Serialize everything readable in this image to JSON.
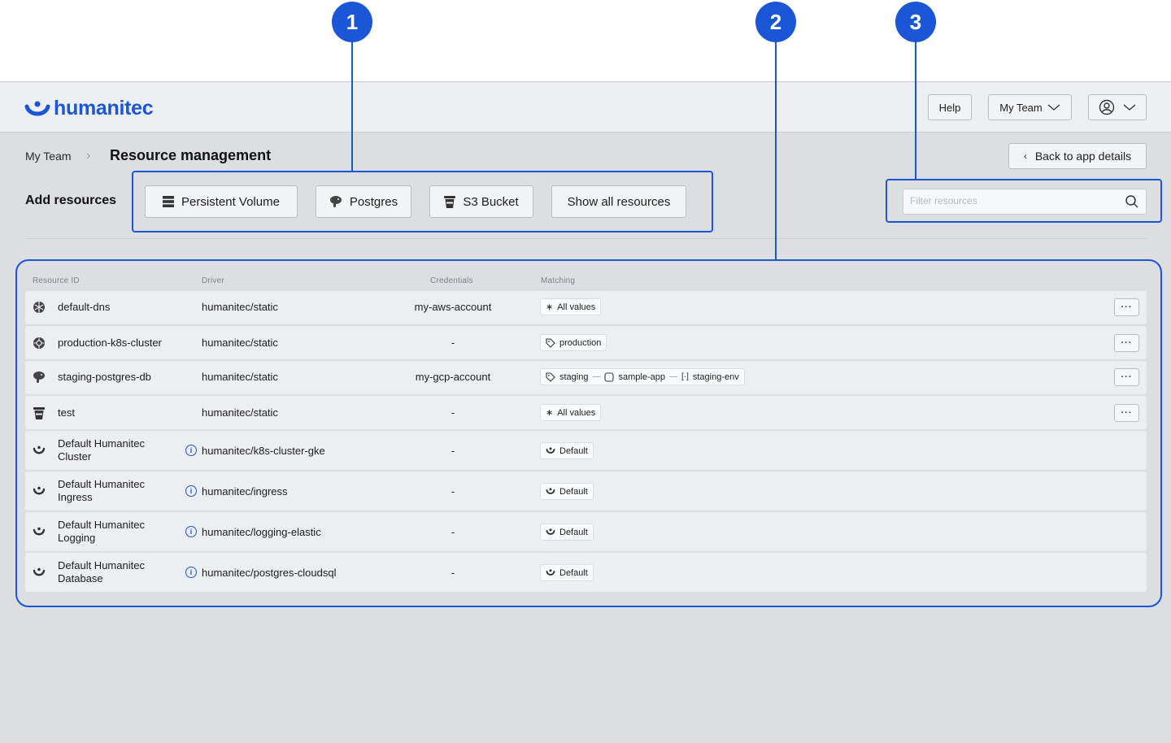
{
  "markers": [
    "1",
    "2",
    "3"
  ],
  "header": {
    "logo_text": "humanitec",
    "help_label": "Help",
    "team_label": "My Team"
  },
  "breadcrumb": {
    "team": "My Team",
    "title": "Resource management"
  },
  "back_button": "Back to app details",
  "add_resources": {
    "label": "Add resources",
    "buttons": [
      "Persistent Volume",
      "Postgres",
      "S3 Bucket",
      "Show all resources"
    ]
  },
  "filter": {
    "placeholder": "Filter resources"
  },
  "table": {
    "headers": [
      "Resource ID",
      "Driver",
      "Credentials",
      "Matching"
    ],
    "rows": [
      {
        "id": "default-dns",
        "icon": "dns-icon",
        "driver": "humanitec/static",
        "credentials": "my-aws-account",
        "matching": [
          {
            "icon": "asterisk-icon",
            "label": "All values"
          }
        ],
        "has_menu": true
      },
      {
        "id": "production-k8s-cluster",
        "icon": "k8s-cluster-icon",
        "driver": "humanitec/static",
        "credentials": "-",
        "matching": [
          {
            "icon": "tag-icon",
            "label": "production"
          }
        ],
        "has_menu": true
      },
      {
        "id": "staging-postgres-db",
        "icon": "postgres-icon",
        "driver": "humanitec/static",
        "credentials": "my-gcp-account",
        "matching": [
          {
            "icon": "tag-icon",
            "label": "staging"
          },
          {
            "icon": "app-icon",
            "label": "sample-app"
          },
          {
            "icon": "env-icon",
            "label": "staging-env"
          }
        ],
        "has_menu": true
      },
      {
        "id": "test",
        "icon": "bucket-icon",
        "driver": "humanitec/static",
        "credentials": "-",
        "matching": [
          {
            "icon": "asterisk-icon",
            "label": "All values"
          }
        ],
        "has_menu": true
      },
      {
        "id": "Default Humanitec Cluster",
        "id_line1": "Default Humanitec",
        "id_line2": "Cluster",
        "icon": "humanitec-icon",
        "driver": "humanitec/k8s-cluster-gke",
        "credentials": "-",
        "matching": [
          {
            "icon": "humanitec-icon",
            "label": "Default"
          }
        ],
        "has_menu": false
      },
      {
        "id": "Default Humanitec Ingress",
        "id_line1": "Default Humanitec",
        "id_line2": "Ingress",
        "icon": "humanitec-icon",
        "driver": "humanitec/ingress",
        "credentials": "-",
        "matching": [
          {
            "icon": "humanitec-icon",
            "label": "Default"
          }
        ],
        "has_menu": false
      },
      {
        "id": "Default Humanitec Logging",
        "id_line1": "Default Humanitec",
        "id_line2": "Logging",
        "icon": "humanitec-icon",
        "driver": "humanitec/logging-elastic",
        "credentials": "-",
        "matching": [
          {
            "icon": "humanitec-icon",
            "label": "Default"
          }
        ],
        "has_menu": false
      },
      {
        "id": "Default Humanitec Database",
        "id_line1": "Default Humanitec",
        "id_line2": "Database",
        "icon": "humanitec-icon",
        "driver": "humanitec/postgres-cloudsql",
        "credentials": "-",
        "matching": [
          {
            "icon": "humanitec-icon",
            "label": "Default"
          }
        ],
        "has_menu": false
      }
    ],
    "menu_label": "···",
    "info_label": "i"
  },
  "colors": {
    "accent": "#1a56d6",
    "row_bg": "#edeef1",
    "page_bg": "#dcdee2"
  }
}
